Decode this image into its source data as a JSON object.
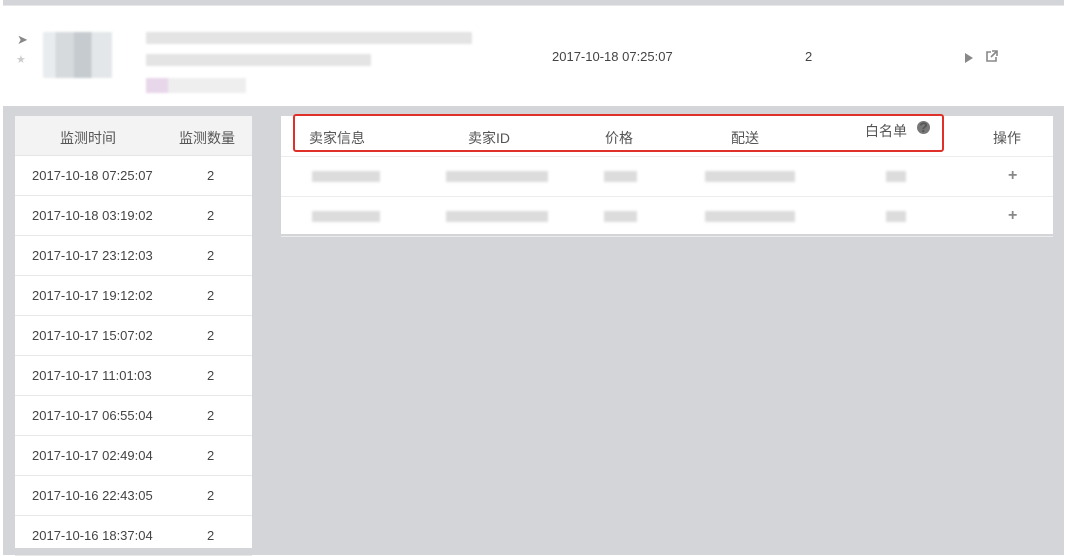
{
  "product": {
    "monitor_time": "2017-10-18 07:25:07",
    "count": "2",
    "icons": [
      "expand-icon",
      "star-icon",
      "play-icon",
      "external-link-icon"
    ]
  },
  "history": {
    "headers": {
      "time": "监测时间",
      "count": "监测数量"
    },
    "rows": [
      {
        "time": "2017-10-18 07:25:07",
        "count": "2"
      },
      {
        "time": "2017-10-18 03:19:02",
        "count": "2"
      },
      {
        "time": "2017-10-17 23:12:03",
        "count": "2"
      },
      {
        "time": "2017-10-17 19:12:02",
        "count": "2"
      },
      {
        "time": "2017-10-17 15:07:02",
        "count": "2"
      },
      {
        "time": "2017-10-17 11:01:03",
        "count": "2"
      },
      {
        "time": "2017-10-17 06:55:04",
        "count": "2"
      },
      {
        "time": "2017-10-17 02:49:04",
        "count": "2"
      },
      {
        "time": "2017-10-16 22:43:05",
        "count": "2"
      },
      {
        "time": "2017-10-16 18:37:04",
        "count": "2"
      }
    ]
  },
  "sellers": {
    "headers": {
      "seller_info": "卖家信息",
      "seller_id": "卖家ID",
      "price": "价格",
      "delivery": "配送",
      "whitelist": "白名单",
      "actions": "操作"
    },
    "help_glyph": "?",
    "add_glyph": "+",
    "highlight_color": "#e0302a"
  }
}
